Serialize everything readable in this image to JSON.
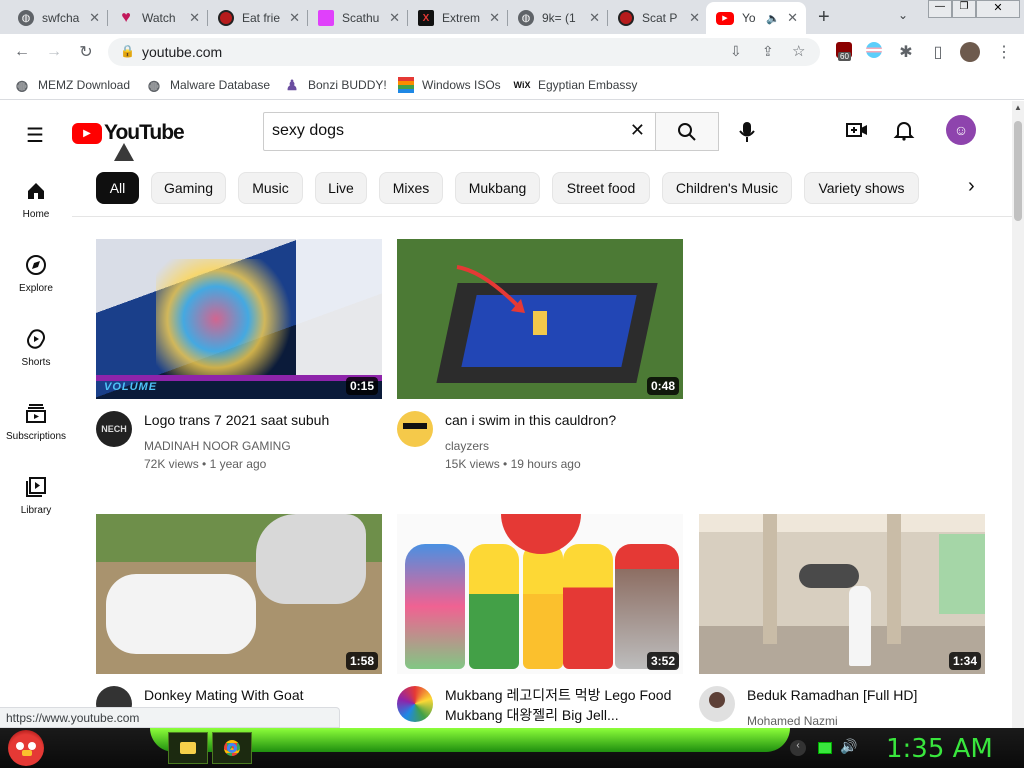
{
  "browser": {
    "tabs": [
      {
        "title": "swfcha",
        "icon": "globe-icon",
        "color": "#5f6368"
      },
      {
        "title": "Watch",
        "icon": "heart-icon",
        "color": "#c2185b"
      },
      {
        "title": "Eat frie",
        "icon": "red-circle-icon",
        "color": "#d32f2f"
      },
      {
        "title": "Scathu",
        "icon": "pink-square-icon",
        "color": "#e040fb"
      },
      {
        "title": "Extrem",
        "icon": "x-logo-icon",
        "color": "#b71c1c"
      },
      {
        "title": "9k= (1",
        "icon": "globe-icon",
        "color": "#5f6368"
      },
      {
        "title": "Scat P",
        "icon": "red-circle-icon",
        "color": "#d32f2f"
      },
      {
        "title": "Yo",
        "icon": "youtube-icon",
        "color": "#ff0000"
      }
    ],
    "new_tab_label": "+",
    "url": "youtube.com",
    "extension_badge": "60",
    "bookmarks": [
      {
        "label": "MEMZ Download",
        "icon": "globe-icon"
      },
      {
        "label": "Malware Database",
        "icon": "globe-icon"
      },
      {
        "label": "Bonzi BUDDY!",
        "icon": "bonzi-icon"
      },
      {
        "label": "Windows ISOs",
        "icon": "windows-icon"
      },
      {
        "label": "Egyptian Embassy",
        "icon": "wix-icon",
        "icon_text": "WiX"
      }
    ],
    "status_url": "https://www.youtube.com"
  },
  "youtube": {
    "logo_text": "YouTube",
    "search": {
      "value": "sexy dogs"
    },
    "sidebar": [
      {
        "label": "Home",
        "icon": "home-icon"
      },
      {
        "label": "Explore",
        "icon": "compass-icon"
      },
      {
        "label": "Shorts",
        "icon": "shorts-icon"
      },
      {
        "label": "Subscriptions",
        "icon": "subscriptions-icon"
      },
      {
        "label": "Library",
        "icon": "library-icon"
      }
    ],
    "chips": [
      "All",
      "Gaming",
      "Music",
      "Live",
      "Mixes",
      "Mukbang",
      "Street food",
      "Children's Music",
      "Variety shows"
    ],
    "videos": [
      {
        "title": "Logo trans 7 2021 saat subuh",
        "channel": "MADINAH NOOR GAMING",
        "views": "72K views",
        "age": "1 year ago",
        "duration": "0:15",
        "thumb_watermark": "VOLUME"
      },
      {
        "title": "can i swim in this cauldron?",
        "channel": "clayzers",
        "views": "15K views",
        "age": "19 hours ago",
        "duration": "0:48"
      },
      {
        "title": "Donkey Mating With Goat",
        "channel": "",
        "views": "",
        "age": "",
        "duration": "1:58"
      },
      {
        "title": "Mukbang 레고디저트 먹방 Lego Food Mukbang 대왕젤리 Big Jell...",
        "channel": "",
        "views": "",
        "age": "",
        "duration": "3:52"
      },
      {
        "title": "Beduk Ramadhan [Full HD]",
        "channel": "Mohamed Nazmi",
        "views": "",
        "age": "",
        "duration": "1:34"
      }
    ],
    "colors": {
      "brand_red": "#ff0000",
      "text": "#0f0f0f",
      "secondary": "#606060"
    }
  },
  "taskbar": {
    "clock": "1:35 AM",
    "start_icon": "angry-bird-icon"
  }
}
